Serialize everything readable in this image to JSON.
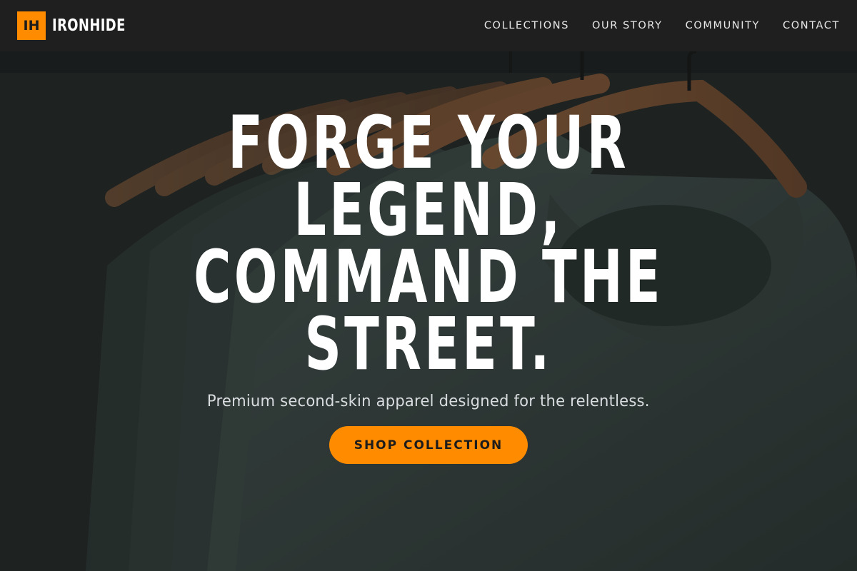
{
  "brand": {
    "mark": "IH",
    "name": "IRONHIDE"
  },
  "nav": {
    "items": [
      {
        "label": "COLLECTIONS"
      },
      {
        "label": "OUR STORY"
      },
      {
        "label": "COMMUNITY"
      },
      {
        "label": "CONTACT"
      }
    ]
  },
  "hero": {
    "headline_lines": [
      "FORGE YOUR",
      "LEGEND,",
      "COMMAND THE",
      "STREET."
    ],
    "tagline": "Premium second-skin apparel designed for the relentless.",
    "cta_label": "SHOP COLLECTION",
    "image": {
      "subject": "dark green t-shirts on wooden hangers",
      "icon": "apparel-photo"
    }
  },
  "colors": {
    "accent": "#ff8c00",
    "header_bg": "#1f1f1f",
    "headline": "#ffffff",
    "tagline": "#d9dde0"
  }
}
